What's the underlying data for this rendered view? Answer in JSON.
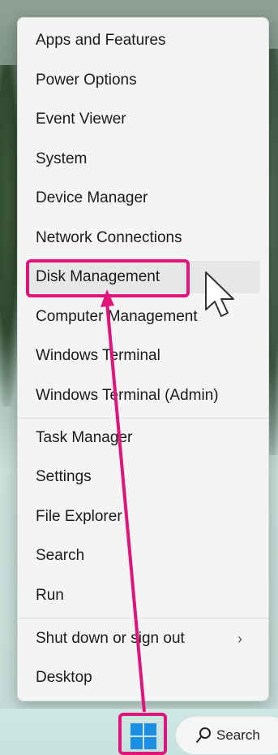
{
  "menu": {
    "items": [
      {
        "label": "Apps and Features"
      },
      {
        "label": "Power Options"
      },
      {
        "label": "Event Viewer"
      },
      {
        "label": "System"
      },
      {
        "label": "Device Manager"
      },
      {
        "label": "Network Connections"
      },
      {
        "label": "Disk Management"
      },
      {
        "label": "Computer Management"
      },
      {
        "label": "Windows Terminal"
      },
      {
        "label": "Windows Terminal (Admin)"
      },
      {
        "label": "Task Manager"
      },
      {
        "label": "Settings"
      },
      {
        "label": "File Explorer"
      },
      {
        "label": "Search"
      },
      {
        "label": "Run"
      },
      {
        "label": "Shut down or sign out"
      },
      {
        "label": "Desktop"
      }
    ],
    "submenu_chevron": "›"
  },
  "taskbar": {
    "search_label": "Search"
  },
  "colors": {
    "annotation": "#e0147b",
    "windows_blue": "#1a8fe3"
  }
}
